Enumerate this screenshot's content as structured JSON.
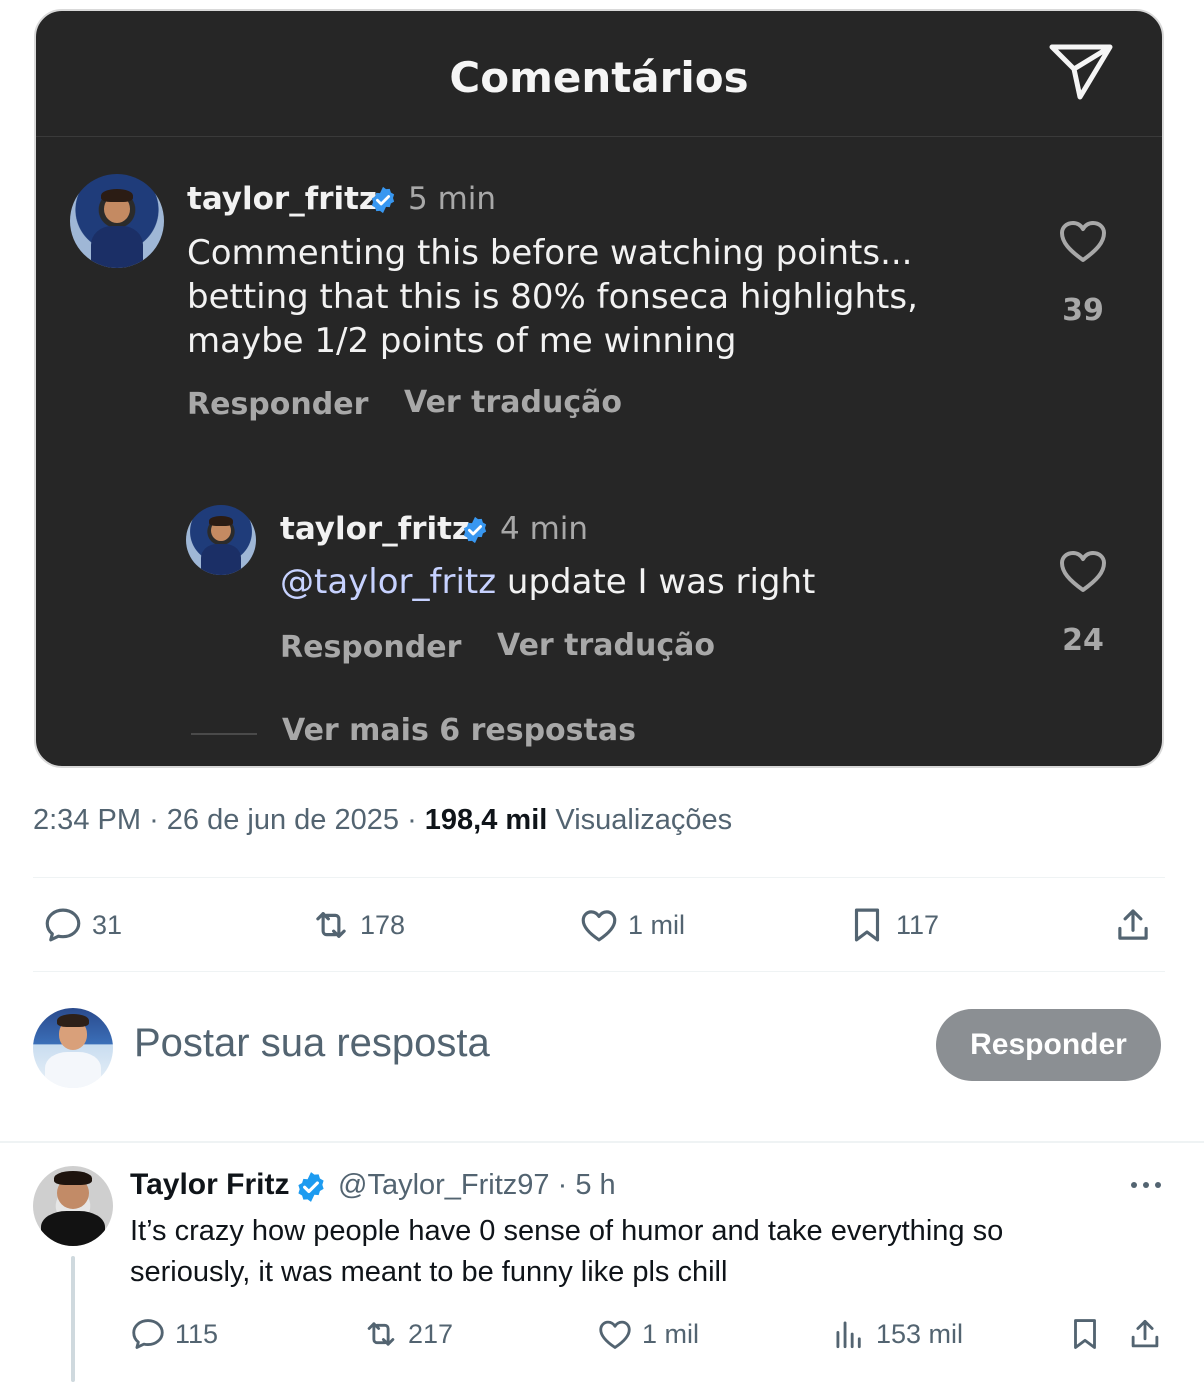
{
  "instagram_card": {
    "title": "Comentários",
    "comment": {
      "username": "taylor_fritz",
      "time": "5 min",
      "text": "Commenting this before watching points... betting that this is 80% fonseca highlights, maybe 1/2 points of me winning",
      "reply_label": "Responder",
      "translate_label": "Ver tradução",
      "likes": "39"
    },
    "reply": {
      "username": "taylor_fritz",
      "time": "4 min",
      "mention": "@taylor_fritz",
      "text": " update I was right",
      "reply_label": "Responder",
      "translate_label": "Ver tradução",
      "likes": "24"
    },
    "more_replies": "Ver mais 6 respostas"
  },
  "tweet_meta": {
    "time": "2:34 PM",
    "date": "26 de jun de 2025",
    "views_count": "198,4 mil",
    "views_label": "Visualizações"
  },
  "tweet_actions": {
    "replies": "31",
    "retweets": "178",
    "likes": "1 mil",
    "bookmarks": "117"
  },
  "composer": {
    "placeholder": "Postar sua resposta",
    "button": "Responder"
  },
  "reply_tweet": {
    "name": "Taylor Fritz",
    "handle": "@Taylor_Fritz97 · 5 h",
    "text": "It’s crazy how people have 0 sense of humor and take everything so seriously, it was meant to be funny like pls chill",
    "replies": "115",
    "retweets": "217",
    "likes": "1 mil",
    "views": "153 mil"
  },
  "colors": {
    "verified": "#1d9bf0",
    "ig_background": "#262626",
    "secondary_text": "#536471",
    "button_disabled": "#8b8f93"
  },
  "icons": [
    "send-icon",
    "heart-icon",
    "verified-icon",
    "reply-icon",
    "retweet-icon",
    "bookmark-icon",
    "share-icon",
    "views-icon",
    "more-icon"
  ]
}
